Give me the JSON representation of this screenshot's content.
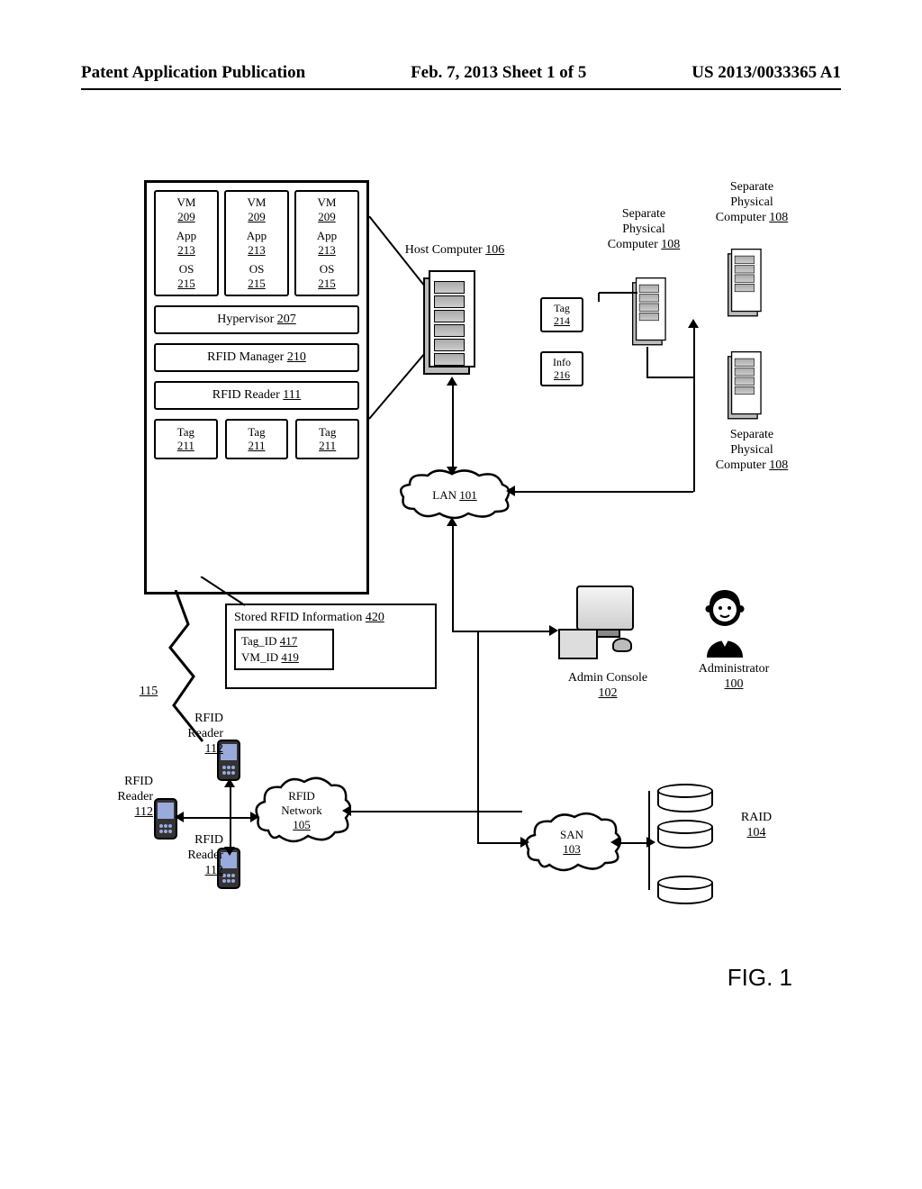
{
  "header": {
    "left": "Patent Application Publication",
    "center": "Feb. 7, 2013  Sheet 1 of 5",
    "right": "US 2013/0033365 A1"
  },
  "figure_caption": "FIG. 1",
  "host": {
    "vm": {
      "label": "VM",
      "ref": "209"
    },
    "app": {
      "label": "App",
      "ref": "213"
    },
    "os": {
      "label": "OS",
      "ref": "215"
    },
    "hypervisor": {
      "label": "Hypervisor",
      "ref": "207"
    },
    "rfid_manager": {
      "label": "RFID Manager",
      "ref": "210"
    },
    "rfid_reader": {
      "label": "RFID Reader",
      "ref": "111"
    },
    "tag": {
      "label": "Tag",
      "ref": "211"
    }
  },
  "callout": {
    "title_label": "Stored RFID Information",
    "title_ref": "420",
    "row1_label": "Tag_ID",
    "row1_ref": "417",
    "row2_label": "VM_ID",
    "row2_ref": "419"
  },
  "host_computer": {
    "label": "Host Computer",
    "ref": "106"
  },
  "remote_tag": {
    "label": "Tag",
    "ref": "214"
  },
  "remote_info": {
    "label": "Info",
    "ref": "216"
  },
  "sep_physical": {
    "label_l1": "Separate",
    "label_l2": "Physical",
    "label_l3": "Computer",
    "ref": "108"
  },
  "clouds": {
    "lan": {
      "label": "LAN",
      "ref": "101"
    },
    "rfid": {
      "label_l1": "RFID",
      "label_l2": "Network",
      "ref": "105"
    },
    "san": {
      "label": "SAN",
      "ref": "103"
    }
  },
  "admin_console": {
    "label": "Admin Console",
    "ref": "102"
  },
  "administrator": {
    "label": "Administrator",
    "ref": "100"
  },
  "raid": {
    "label": "RAID",
    "ref": "104"
  },
  "rfid_reader_device": {
    "label_l1": "RFID",
    "label_l2": "Reader",
    "ref": "112"
  },
  "wireless_ref": "115"
}
